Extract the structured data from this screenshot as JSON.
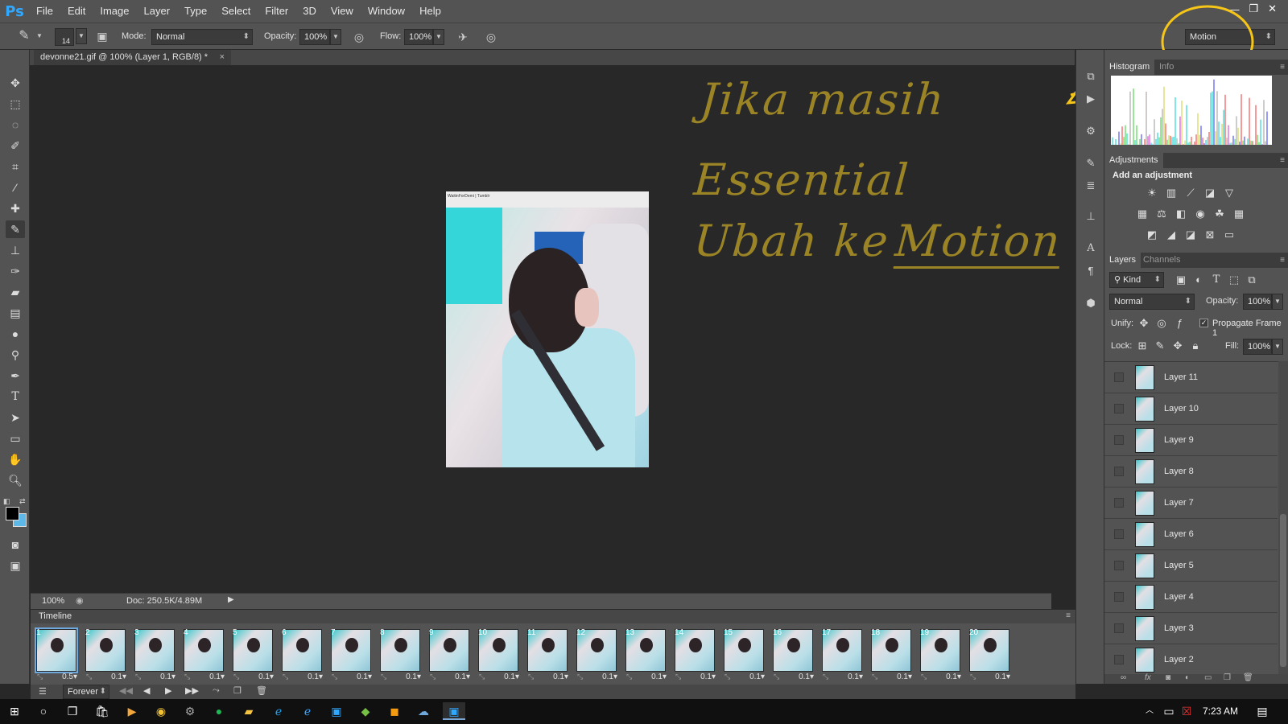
{
  "menubar": {
    "logo": "Ps",
    "items": [
      "File",
      "Edit",
      "Image",
      "Layer",
      "Type",
      "Select",
      "Filter",
      "3D",
      "View",
      "Window",
      "Help"
    ],
    "window_buttons": [
      "—",
      "❐",
      "✕"
    ]
  },
  "options": {
    "brush_size": "14",
    "mode_label": "Mode:",
    "mode_value": "Normal",
    "opacity_label": "Opacity:",
    "opacity_value": "100%",
    "flow_label": "Flow:",
    "flow_value": "100%",
    "workspace": "Motion"
  },
  "document": {
    "tab_title": "devonne21.gif @ 100% (Layer 1, RGB/8) *",
    "close": "×",
    "watermark": "WaitinForDemi | Tumblr",
    "zoom": "100%",
    "doc_info": "Doc: 250.5K/4.89M"
  },
  "annotation": {
    "line1": "Jika masih",
    "line2": "Essential",
    "line3a": "Ubah ke",
    "line3b": "Motion",
    "color": "#9b8426",
    "circle_color": "#f5c518"
  },
  "timeline": {
    "title": "Timeline",
    "loop": "Forever",
    "frames": [
      {
        "num": "1",
        "delay": "0.5"
      },
      {
        "num": "2",
        "delay": "0.1"
      },
      {
        "num": "3",
        "delay": "0.1"
      },
      {
        "num": "4",
        "delay": "0.1"
      },
      {
        "num": "5",
        "delay": "0.1"
      },
      {
        "num": "6",
        "delay": "0.1"
      },
      {
        "num": "7",
        "delay": "0.1"
      },
      {
        "num": "8",
        "delay": "0.1"
      },
      {
        "num": "9",
        "delay": "0.1"
      },
      {
        "num": "10",
        "delay": "0.1"
      },
      {
        "num": "11",
        "delay": "0.1"
      },
      {
        "num": "12",
        "delay": "0.1"
      },
      {
        "num": "13",
        "delay": "0.1"
      },
      {
        "num": "14",
        "delay": "0.1"
      },
      {
        "num": "15",
        "delay": "0.1"
      },
      {
        "num": "16",
        "delay": "0.1"
      },
      {
        "num": "17",
        "delay": "0.1"
      },
      {
        "num": "18",
        "delay": "0.1"
      },
      {
        "num": "19",
        "delay": "0.1"
      },
      {
        "num": "20",
        "delay": "0.1"
      }
    ]
  },
  "panels": {
    "histogram_tab": "Histogram",
    "info_tab": "Info",
    "adjustments_tab": "Adjustments",
    "add_adjustment": "Add an adjustment",
    "layers_tab": "Layers",
    "channels_tab": "Channels",
    "kind": "Kind",
    "blend_mode": "Normal",
    "opacity_label": "Opacity:",
    "opacity_value": "100%",
    "unify_label": "Unify:",
    "propagate": "Propagate Frame 1",
    "lock_label": "Lock:",
    "fill_label": "Fill:",
    "fill_value": "100%",
    "layers": [
      "Layer 11",
      "Layer 10",
      "Layer 9",
      "Layer 8",
      "Layer 7",
      "Layer 6",
      "Layer 5",
      "Layer 4",
      "Layer 3",
      "Layer 2"
    ]
  },
  "taskbar": {
    "time": "7:23 AM"
  }
}
